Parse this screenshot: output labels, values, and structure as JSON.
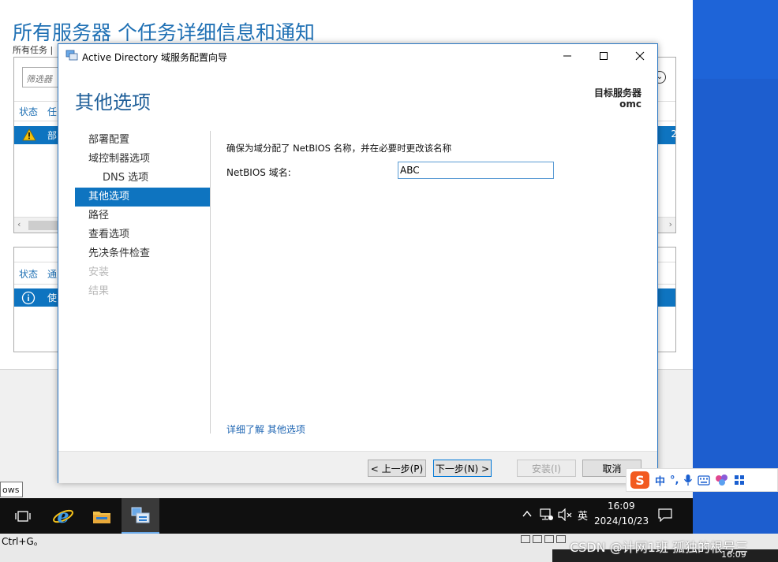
{
  "background": {
    "title": "所有服务器 个任务详细信息和通知",
    "subtitle": "所有任务 |",
    "filter_placeholder": "筛选器",
    "panel1_headers": [
      "状态",
      "任"
    ],
    "panel1_row_text": "部",
    "panel1_right_num": "2",
    "panel2_headers": [
      "状态",
      "通"
    ],
    "panel2_row_text": "使",
    "tooltip": "ows",
    "bottom_hint": "Ctrl+G。"
  },
  "dialog": {
    "title": "Active Directory 域服务配置向导",
    "heading": "其他选项",
    "target_label": "目标服务器",
    "target_value": "omc",
    "nav": [
      {
        "label": "部署配置",
        "state": "normal"
      },
      {
        "label": "域控制器选项",
        "state": "normal"
      },
      {
        "label": "DNS 选项",
        "state": "sub"
      },
      {
        "label": "其他选项",
        "state": "active"
      },
      {
        "label": "路径",
        "state": "normal"
      },
      {
        "label": "查看选项",
        "state": "normal"
      },
      {
        "label": "先决条件检查",
        "state": "normal"
      },
      {
        "label": "安装",
        "state": "disabled"
      },
      {
        "label": "结果",
        "state": "disabled"
      }
    ],
    "description": "确保为域分配了 NetBIOS 名称，并在必要时更改该名称",
    "netbios_label": "NetBIOS 域名:",
    "netbios_value": "ABC",
    "learn_more": "详细了解 其他选项",
    "buttons": {
      "prev": "< 上一步(P)",
      "next": "下一步(N) >",
      "install": "安装(I)",
      "cancel": "取消"
    }
  },
  "taskbar": {
    "ime_lang": "英",
    "time": "16:09",
    "date": "2024/10/23",
    "time_small": "16:09"
  },
  "ime_toolbar": {
    "mode": "中"
  },
  "watermark": "CSDN @计网1班 孤独的根号三",
  "colors": {
    "accent": "#0e74c0",
    "heading": "#1f70b4",
    "desktop": "#1d5ecf",
    "taskbar": "#101010"
  },
  "icons": [
    "start-icon",
    "task-view-icon",
    "ie-icon",
    "file-explorer-icon",
    "server-manager-icon",
    "show-hidden-icons-icon",
    "network-icon",
    "volume-muted-icon",
    "notifications-icon",
    "warning-icon",
    "info-icon",
    "sogou-icon",
    "microphone-icon",
    "keyboard-icon",
    "skin-icon",
    "grid-icon"
  ]
}
